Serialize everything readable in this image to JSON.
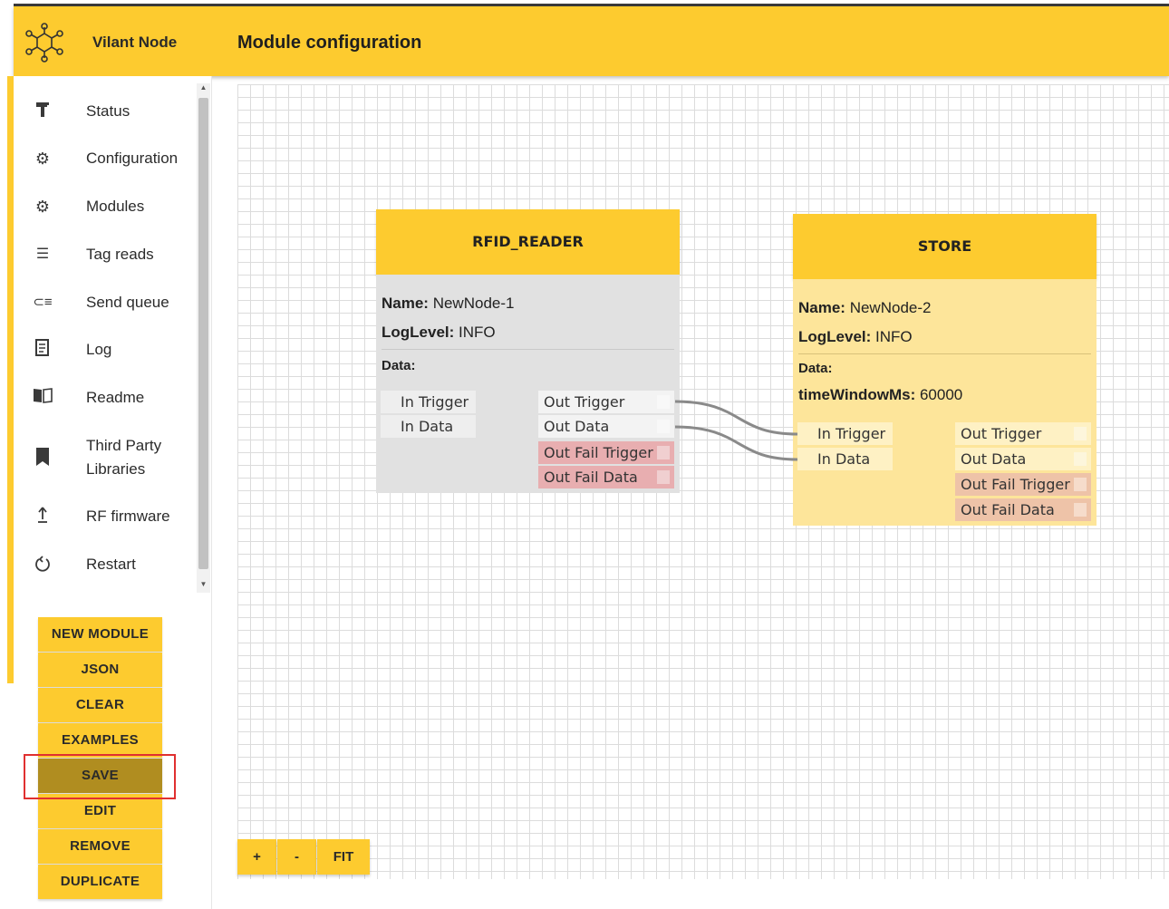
{
  "app": {
    "brand": "Vilant Node",
    "page_title": "Module configuration"
  },
  "sidebar": {
    "items": [
      {
        "label": "Status",
        "icon": "hammer-icon"
      },
      {
        "label": "Configuration",
        "icon": "gear-icon"
      },
      {
        "label": "Modules",
        "icon": "gear-icon"
      },
      {
        "label": "Tag reads",
        "icon": "list-icon"
      },
      {
        "label": "Send queue",
        "icon": "queue-icon"
      },
      {
        "label": "Log",
        "icon": "log-icon"
      },
      {
        "label": "Readme",
        "icon": "book-open-icon"
      },
      {
        "label": "Third Party\nLibraries",
        "icon": "bookmark-book-icon"
      },
      {
        "label": "RF firmware",
        "icon": "upload-icon"
      },
      {
        "label": "Restart",
        "icon": "restart-icon"
      }
    ]
  },
  "actions": {
    "new_module": "NEW MODULE",
    "json": "JSON",
    "clear": "CLEAR",
    "examples": "EXAMPLES",
    "save": "SAVE",
    "edit": "EDIT",
    "remove": "REMOVE",
    "duplicate": "DUPLICATE"
  },
  "zoom": {
    "plus": "+",
    "minus": "-",
    "fit": "FIT"
  },
  "nodes": {
    "rfid": {
      "title": "RFID_READER",
      "name_key": "Name:",
      "name_val": "NewNode-1",
      "log_key": "LogLevel:",
      "log_val": "INFO",
      "data_key": "Data:",
      "in_trigger": "In Trigger",
      "in_data": "In Data",
      "out_trigger": "Out Trigger",
      "out_data": "Out Data",
      "out_fail_trigger": "Out Fail Trigger",
      "out_fail_data": "Out Fail Data"
    },
    "store": {
      "title": "STORE",
      "name_key": "Name:",
      "name_val": "NewNode-2",
      "log_key": "LogLevel:",
      "log_val": "INFO",
      "data_key": "Data:",
      "tw_key": "timeWindowMs:",
      "tw_val": "60000",
      "in_trigger": "In Trigger",
      "in_data": "In Data",
      "out_trigger": "Out Trigger",
      "out_data": "Out Data",
      "out_fail_trigger": "Out Fail Trigger",
      "out_fail_data": "Out Fail Data"
    }
  },
  "colors": {
    "accent": "#fdcb2f",
    "accent_dark": "#b08d20",
    "fail": "#e8aeb0",
    "selected_node": "#fde59a"
  }
}
